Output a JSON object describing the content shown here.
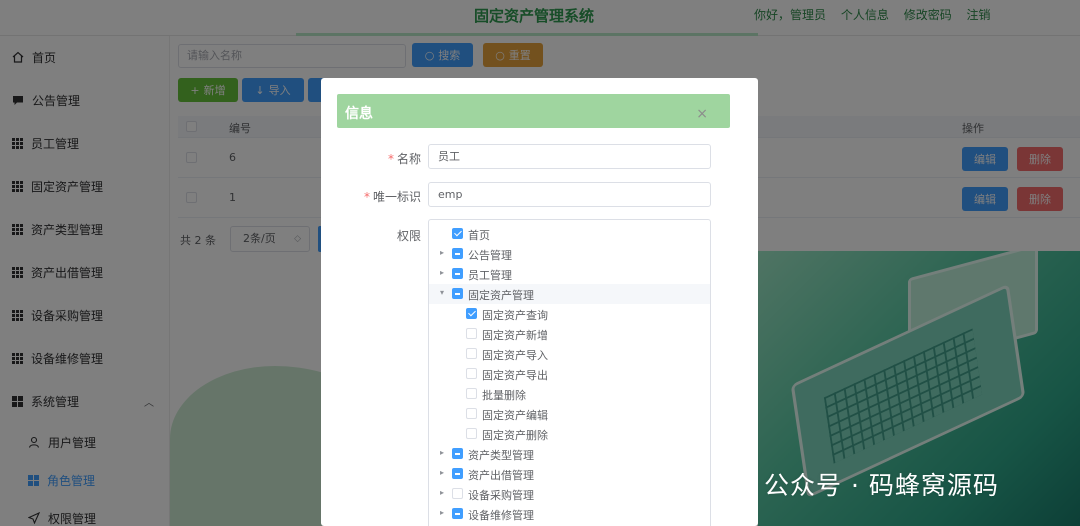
{
  "header": {
    "title": "固定资产管理系统",
    "links": [
      "你好，管理员",
      "个人信息",
      "修改密码",
      "注销"
    ]
  },
  "sidebar": {
    "items": [
      {
        "label": "首页",
        "icon": "home-icon"
      },
      {
        "label": "公告管理",
        "icon": "message-icon"
      },
      {
        "label": "员工管理",
        "icon": "grid-icon"
      },
      {
        "label": "固定资产管理",
        "icon": "grid-icon"
      },
      {
        "label": "资产类型管理",
        "icon": "grid-icon"
      },
      {
        "label": "资产出借管理",
        "icon": "grid-icon"
      },
      {
        "label": "设备采购管理",
        "icon": "grid-icon"
      },
      {
        "label": "设备维修管理",
        "icon": "grid-icon"
      },
      {
        "label": "系统管理",
        "icon": "grid4-icon"
      },
      {
        "label": "用户管理",
        "icon": "user-icon"
      },
      {
        "label": "角色管理",
        "icon": "grid4-icon",
        "active": true
      },
      {
        "label": "权限管理",
        "icon": "send-icon"
      }
    ]
  },
  "toolbar": {
    "search_placeholder": "请输入名称",
    "search_label": "搜索",
    "reset_label": "重置",
    "add_label": "新增",
    "import_label": "导入"
  },
  "table": {
    "headers": {
      "no": "编号",
      "op": "操作"
    },
    "rows": [
      {
        "no": "6",
        "edit": "编辑",
        "delete": "删除"
      },
      {
        "no": "1",
        "edit": "编辑",
        "delete": "删除"
      }
    ]
  },
  "pager": {
    "total": "共 2 条",
    "page_size": "2条/页"
  },
  "dialog": {
    "title": "信息",
    "close": "×",
    "name_label": "名称",
    "name_value": "员工",
    "key_label": "唯一标识",
    "key_value": "emp",
    "perm_label": "权限",
    "tree": [
      {
        "label": "首页",
        "level": 0,
        "arrow": "",
        "state": "checked"
      },
      {
        "label": "公告管理",
        "level": 0,
        "arrow": "▸",
        "state": "partial"
      },
      {
        "label": "员工管理",
        "level": 0,
        "arrow": "▸",
        "state": "partial"
      },
      {
        "label": "固定资产管理",
        "level": 0,
        "arrow": "▾",
        "state": "partial",
        "highlight": true
      },
      {
        "label": "固定资产查询",
        "level": 1,
        "arrow": "",
        "state": "checked"
      },
      {
        "label": "固定资产新增",
        "level": 1,
        "arrow": "",
        "state": "unchecked"
      },
      {
        "label": "固定资产导入",
        "level": 1,
        "arrow": "",
        "state": "unchecked"
      },
      {
        "label": "固定资产导出",
        "level": 1,
        "arrow": "",
        "state": "unchecked"
      },
      {
        "label": "批量删除",
        "level": 1,
        "arrow": "",
        "state": "unchecked"
      },
      {
        "label": "固定资产编辑",
        "level": 1,
        "arrow": "",
        "state": "unchecked"
      },
      {
        "label": "固定资产删除",
        "level": 1,
        "arrow": "",
        "state": "unchecked"
      },
      {
        "label": "资产类型管理",
        "level": 0,
        "arrow": "▸",
        "state": "partial"
      },
      {
        "label": "资产出借管理",
        "level": 0,
        "arrow": "▸",
        "state": "partial"
      },
      {
        "label": "设备采购管理",
        "level": 0,
        "arrow": "▸",
        "state": "unchecked"
      },
      {
        "label": "设备维修管理",
        "level": 0,
        "arrow": "▸",
        "state": "partial"
      }
    ]
  },
  "watermark": {
    "text": "公众号 · 码蜂窝源码"
  },
  "colors": {
    "primary": "#409eff",
    "success": "#67c23a",
    "warning": "#e6a23c",
    "danger": "#f56c6c",
    "dialog_header": "#9fd59f",
    "title_green": "#2e9a50"
  }
}
